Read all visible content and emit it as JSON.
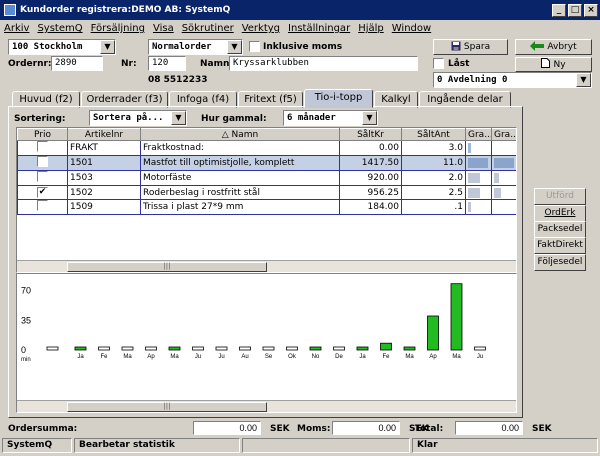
{
  "window": {
    "title": "Kundorder registrera:DEMO AB: SystemQ",
    "min": "_",
    "max": "□",
    "close": "×"
  },
  "menu": [
    "Arkiv",
    "SystemQ",
    "Försäljning",
    "Visa",
    "Sökrutiner",
    "Verktyg",
    "Inställningar",
    "Hjälp",
    "Window"
  ],
  "header": {
    "customer_combo": "100   Stockholm",
    "ordertype_combo": "Normalorder",
    "inclusive_moms": "Inklusive moms",
    "ordernr_label": "Ordernr:",
    "ordernr": "2890",
    "nr_label": "Nr:",
    "nr": "120",
    "namn_label": "Namn:",
    "namn": "Kryssarklubben",
    "phone": "08 5512233",
    "locked": "Låst",
    "department_combo": "0   Avdelning 0"
  },
  "buttons": {
    "spara": "Spara",
    "avbryt": "Avbryt",
    "ny": "Ny"
  },
  "tabs": [
    "Huvud (f2)",
    "Orderrader (f3)",
    "Infoga (f4)",
    "Fritext (f5)",
    "Tio-i-topp",
    "Kalkyl",
    "Ingående delar"
  ],
  "active_tab": "Tio-i-topp",
  "filters": {
    "sortering_label": "Sortering:",
    "sortering_value": "Sortera på...",
    "hurgammal_label": "Hur gammal:",
    "hurgammal_value": "6 månader"
  },
  "table": {
    "columns": [
      "Prio",
      "Artikelnr",
      "Namn",
      "SåltKr",
      "SåltAnt",
      "Gra...",
      "Gra..."
    ],
    "rows": [
      {
        "checked": "",
        "artikelnr": "FRAKT",
        "namn": "Fraktkostnad:",
        "saltkr": "0.00",
        "saltant": "3.0"
      },
      {
        "checked": "",
        "artikelnr": "1501",
        "namn": "Mastfot till optimistjolle, komplett",
        "saltkr": "1417.50",
        "saltant": "11.0"
      },
      {
        "checked": "",
        "artikelnr": "1503",
        "namn": "Motorfäste",
        "saltkr": "920.00",
        "saltant": "2.0"
      },
      {
        "checked": "✔",
        "artikelnr": "1502",
        "namn": "Roderbeslag  i rostfritt stål",
        "saltkr": "956.25",
        "saltant": "2.5"
      },
      {
        "checked": "",
        "artikelnr": "1509",
        "namn": "Trissa i plast 27*9 mm",
        "saltkr": "184.00",
        "saltant": ".1"
      }
    ]
  },
  "side_buttons": [
    "Utförd",
    "OrdErk",
    "Packsedel",
    "FaktDirekt",
    "Följesedel"
  ],
  "chart_data": {
    "type": "bar",
    "categories": [
      "min",
      "Ja",
      "Fe",
      "Ma",
      "Ap",
      "Ma",
      "Ju",
      "Ju",
      "Au",
      "Se",
      "Ok",
      "No",
      "De",
      "Ja",
      "Fe",
      "Ma",
      "Ap",
      "Ma",
      "Ju"
    ],
    "values": [
      0,
      3,
      0,
      0,
      0,
      1,
      0,
      0,
      0,
      0,
      0,
      3,
      0,
      2,
      8,
      3,
      40,
      78,
      0
    ],
    "yticks": [
      "70",
      "35",
      "0"
    ],
    "ylim": [
      0,
      80
    ],
    "bar_color": "#22bb22"
  },
  "footer": {
    "ordersumma_label": "Ordersumma:",
    "ordersumma": "0.00",
    "sek1": "SEK",
    "moms_label": "Moms:",
    "moms": "0.00",
    "sek2": "SEK",
    "total_label": "Total:",
    "total": "0.00",
    "sek3": "SEK"
  },
  "status": {
    "app": "SystemQ",
    "message": "Bearbetar statistik",
    "state": "Klar"
  }
}
